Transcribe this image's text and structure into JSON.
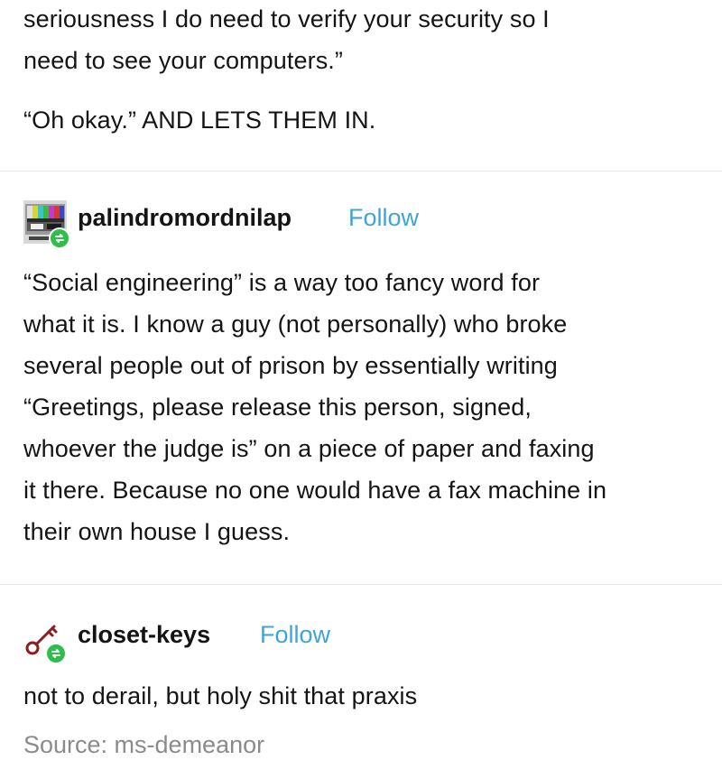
{
  "top_post": {
    "lines": [
      "seriousness I do need to verify your security so I",
      "need to see your computers.”"
    ],
    "closing": "“Oh okay.” AND LETS THEM IN."
  },
  "post_palindrome": {
    "username": "palindromordnilap",
    "follow_label": "Follow",
    "avatar_icon": "tv-test-pattern-avatar",
    "badge_icon": "reblog-icon",
    "lines": [
      "“Social engineering” is a way too fancy word for",
      "what it is. I know a guy (not personally) who broke",
      "several people out of prison by essentially writing",
      "“Greetings, please release this person, signed,",
      "whoever the judge is” on a piece of paper and faxing",
      "it there. Because no one would have a fax machine in",
      "their own house I guess."
    ]
  },
  "post_closet": {
    "username": "closet-keys",
    "follow_label": "Follow",
    "avatar_icon": "key-avatar",
    "badge_icon": "reblog-icon",
    "lines": [
      "not to derail, but holy shit that praxis"
    ]
  },
  "source": {
    "label": "Source: ms-demeanor"
  },
  "colors": {
    "follow": "#3fa5d6",
    "reblog_badge": "#2fbd4c",
    "source_text": "#8b8b8b",
    "divider": "#e7e7e7"
  }
}
